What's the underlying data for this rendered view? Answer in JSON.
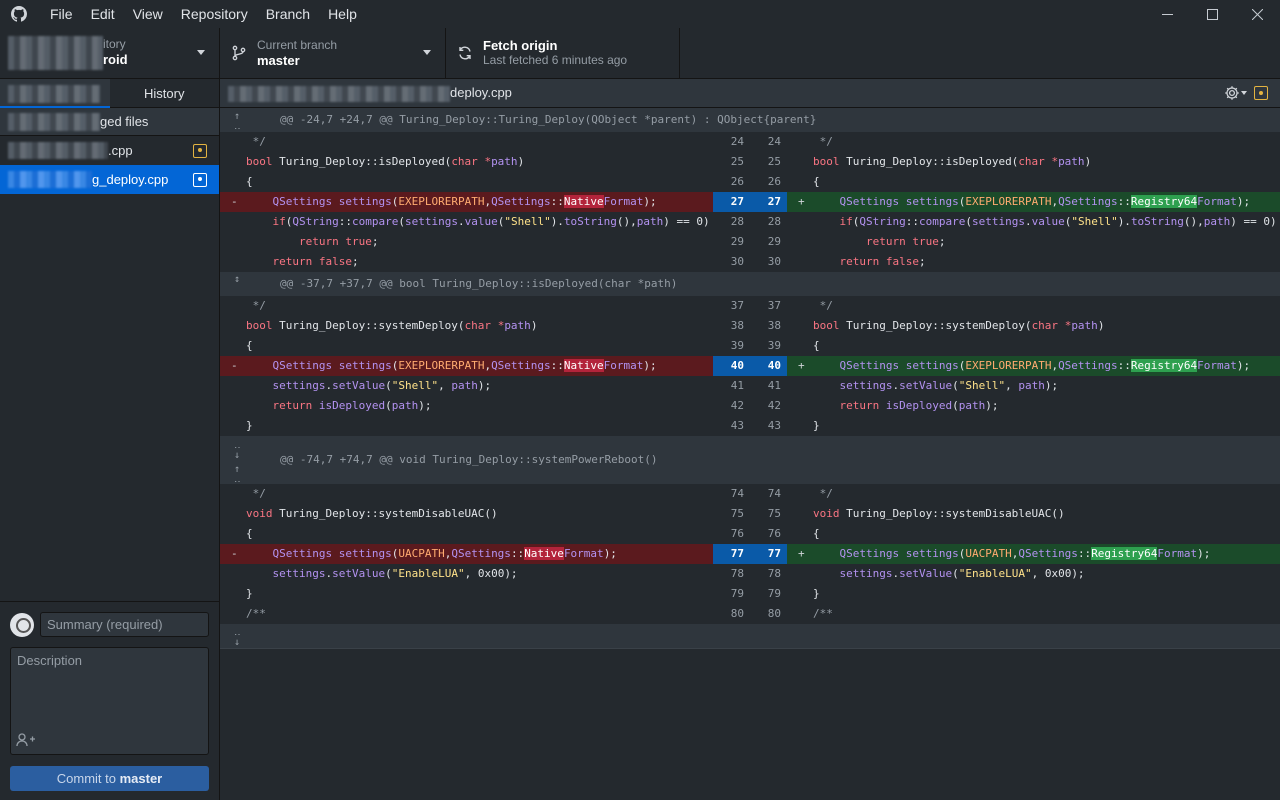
{
  "menu": [
    "File",
    "Edit",
    "View",
    "Repository",
    "Branch",
    "Help"
  ],
  "toolbar": {
    "repo_label": "Current repository",
    "repo_label_visible": "itory",
    "repo_value_visible": "roid",
    "branch_label": "Current branch",
    "branch_value": "master",
    "fetch_label": "Fetch origin",
    "fetch_sub": "Last fetched 6 minutes ago"
  },
  "sidebar": {
    "tab_changes": "",
    "tab_history": "History",
    "changes_header": "ged files",
    "files": [
      {
        "name": ".cpp",
        "selected": false
      },
      {
        "name": "g_deploy.cpp",
        "selected": true
      }
    ]
  },
  "commit": {
    "summary_placeholder": "Summary (required)",
    "description_placeholder": "Description",
    "button_prefix": "Commit to ",
    "button_branch": "master"
  },
  "diff": {
    "file_path": "deploy.cpp",
    "hunks": [
      "@@ -24,7 +24,7 @@ Turing_Deploy::Turing_Deploy(QObject *parent) : QObject{parent}",
      "@@ -37,7 +37,7 @@ bool Turing_Deploy::isDeployed(char *path)",
      "@@ -74,7 +74,7 @@ void Turing_Deploy::systemPowerReboot()"
    ],
    "line_numbers": {
      "h1": [
        "24",
        "25",
        "26",
        "27",
        "28",
        "29",
        "30"
      ],
      "h2": [
        "37",
        "38",
        "39",
        "40",
        "41",
        "42",
        "43"
      ],
      "h3": [
        "74",
        "75",
        "76",
        "77",
        "78",
        "79",
        "80"
      ]
    },
    "markers": {
      "del": "-",
      "add": "+"
    }
  },
  "colors": {
    "accent": "#0366d6",
    "deleted_bg": "#5b1a1e",
    "added_bg": "#1b4b2a",
    "modified": "#e3b341"
  }
}
